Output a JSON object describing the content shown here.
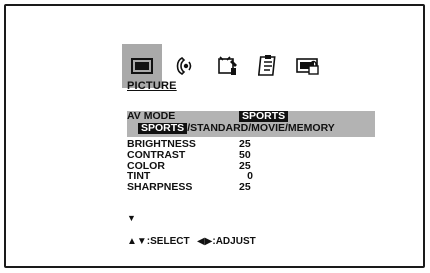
{
  "menu": {
    "title": "PICTURE",
    "icons": [
      "picture-tv-icon",
      "sound-speaker-icon",
      "setup-wrench-icon",
      "clipboard-list-icon",
      "lock-icon"
    ],
    "av_mode": {
      "label": "AV MODE",
      "value": "SPORTS"
    },
    "av_options": {
      "selected": "SPORTS",
      "rest": "/STANDARD/MOVIE/MEMORY"
    },
    "items": [
      {
        "label": "BRIGHTNESS",
        "value": "25"
      },
      {
        "label": "CONTRAST",
        "value": "50"
      },
      {
        "label": "COLOR",
        "value": "25"
      },
      {
        "label": "TINT",
        "value": "0"
      },
      {
        "label": "SHARPNESS",
        "value": "25"
      }
    ],
    "more_arrow": "▼"
  },
  "footer": {
    "select_hint": "▲▼:SELECT",
    "adjust_hint": "◀▶:ADJUST"
  }
}
